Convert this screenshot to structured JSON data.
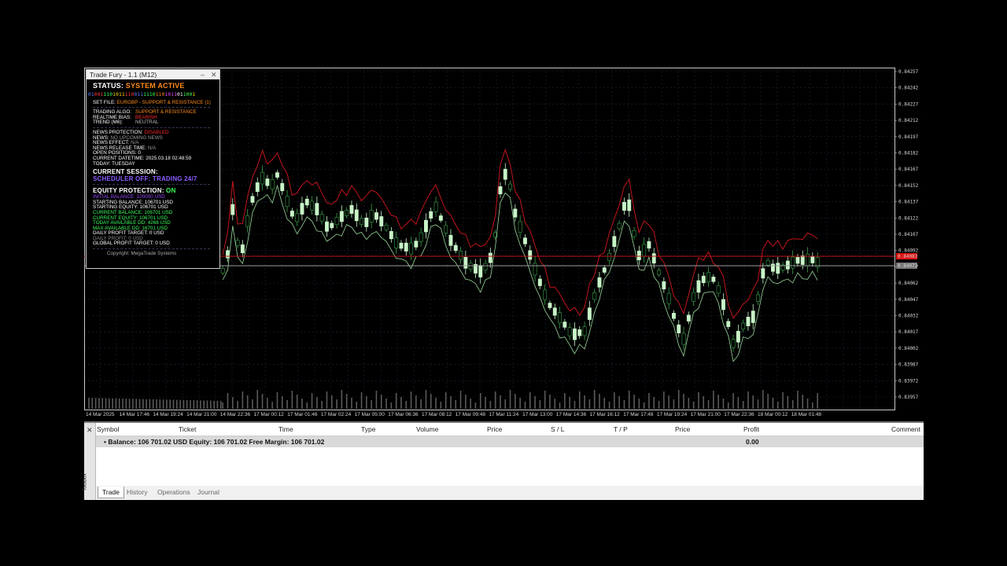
{
  "chart": {
    "price_labels": [
      "0.84257",
      "0.84242",
      "0.84227",
      "0.84212",
      "0.84197",
      "0.84182",
      "0.84167",
      "0.84152",
      "0.84137",
      "0.84122",
      "0.84107",
      "0.84092",
      "0.84077",
      "0.84062",
      "0.84047",
      "0.84032",
      "0.84017",
      "0.84002",
      "0.83987",
      "0.83972",
      "0.83957"
    ],
    "time_labels": [
      "14 Mar 2025",
      "14 Mar 17:46",
      "14 Mar 19:24",
      "14 Mar 21:00",
      "14 Mar 22:36",
      "17 Mar 00:12",
      "17 Mar 01:46",
      "17 Mar 02:24",
      "17 Mar 05:00",
      "17 Mar 06:36",
      "17 Mar 08:12",
      "17 Mar 09:48",
      "17 Mar 11:24",
      "17 Mar 13:00",
      "17 Mar 14:36",
      "17 Mar 16:12",
      "17 Mar 17:48",
      "17 Mar 19:24",
      "17 Mar 21:00",
      "17 Mar 22:36",
      "18 Mar 00:12",
      "18 Mar 01:48"
    ],
    "ask_tag": "0.84083",
    "bid_tag": "0.84072",
    "colors": {
      "bull": "#c8f5c8",
      "bear": "#3aa04a",
      "upper_band": "#c0151b",
      "lower_band": "#9ad79a",
      "ask_line": "#c0151b",
      "bid_line": "#9a9a9a",
      "volume": "#5a5a5a",
      "grid": "#1d2a3a"
    }
  },
  "ea": {
    "title": "Trade Fury - 1.1 (M12)",
    "minimize_icon": "–",
    "close_icon": "✕",
    "status_label": "STATUS:",
    "status_value": "SYSTEM ACTIVE",
    "binary_segments": [
      {
        "text": "01",
        "color": "#5b7cff"
      },
      {
        "text": "001",
        "color": "#ff3a3a"
      },
      {
        "text": "110",
        "color": "#3aff5a"
      },
      {
        "text": "1011",
        "color": "#ffd800"
      },
      {
        "text": "110",
        "color": "#ff3a3a"
      },
      {
        "text": "011",
        "color": "#5b7cff"
      },
      {
        "text": "1110",
        "color": "#3aff5a"
      },
      {
        "text": "110",
        "color": "#ff8c1a"
      },
      {
        "text": "1011",
        "color": "#e04aff"
      },
      {
        "text": "01",
        "color": "#ffffff"
      },
      {
        "text": "100",
        "color": "#3aff5a"
      },
      {
        "text": "1",
        "color": "#ffd800"
      }
    ],
    "set_file_label": "SET FILE:",
    "set_file_value": "EURGBP - SUPPORT & RESISTANCE (1)",
    "algo_label": "TRADING ALGO:",
    "algo_value": "SUPPORT & RESISTANCE",
    "bias_label": "REALTIME BIAS:",
    "bias_value": "BEARISH",
    "trend_label": "TREND (M6):",
    "trend_value": "NEUTRAL",
    "news_protection_label": "NEWS PROTECTION:",
    "news_protection_value": "DISABLED",
    "news_label": "NEWS:",
    "news_value": "NO UPCOMING NEWS",
    "news_effect_label": "NEWS EFFECT:",
    "news_effect_value": "N/A",
    "news_release_label": "NEWS RELEASE TIME:",
    "news_release_value": "N/A",
    "open_positions_label": "OPEN POSITIONS:",
    "open_positions_value": "0",
    "datetime_label": "CURRENT DATETIME:",
    "datetime_value": "2025.03.18 02:48:59",
    "today_label": "TODAY:",
    "today_value": "TUESDAY",
    "session_heading": "CURRENT SESSION:",
    "session_value": "SCHEDULER OFF: TRADING 24/7",
    "equity_heading": "EQUITY PROTECTION:",
    "equity_state": "ON",
    "initial_balance": "INITIAL BALANCE: 100000 USD",
    "starting_balance": "STARTING BALANCE: 106701 USD",
    "starting_equity": "STARTING EQUITY: 106701 USD",
    "current_balance": "CURRENT BALANCE: 106701 USD",
    "current_equity": "CURRENT EQUITY: 106701 USD",
    "today_available_dd": "TODAY AVAILABLE DD: 4268 USD",
    "max_available_dd": "MAX AVAILABLE DD: 16701 USD",
    "daily_profit_target": "DAILY PROFIT TARGET: 0 USD",
    "daily_profit": "DAILY PROFIT: 0 USD",
    "global_profit_target": "GLOBAL PROFIT TARGET: 0 USD",
    "copyright": "Copyright: MegaTrade Systems"
  },
  "toolbox": {
    "close_icon": "✕",
    "side_label": "Toolbox",
    "columns": [
      "Symbol",
      "Ticket",
      "Time",
      "Type",
      "Volume",
      "Price",
      "S / L",
      "T / P",
      "Price",
      "Profit",
      "Comment"
    ],
    "balance_row": "•  Balance: 106 701.02 USD  Equity: 106 701.02  Free Margin: 106 701.02",
    "profit_total": "0.00",
    "tabs": [
      "Trade",
      "History",
      "Operations",
      "Journal"
    ]
  }
}
